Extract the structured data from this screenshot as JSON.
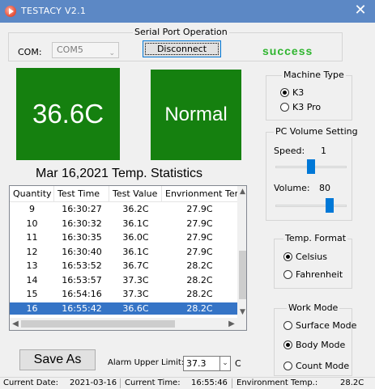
{
  "window": {
    "title": "TESTACY  V2.1",
    "close_glyph": "✕"
  },
  "serial": {
    "group_title": "Serial Port Operation",
    "com_label": "COM:",
    "com_value": "COM5",
    "disconnect_label": "Disconnect",
    "status_text": "success"
  },
  "display": {
    "temperature": "36.6C",
    "condition": "Normal",
    "panel_color": "#15800f"
  },
  "stats": {
    "title": "Mar 16,2021 Temp. Statistics",
    "columns": [
      "Quantity",
      "Test Time",
      "Test Value",
      "Envrionment Ten"
    ],
    "rows": [
      {
        "q": "9",
        "time": "16:30:27",
        "value": "36.2C",
        "env": "27.9C"
      },
      {
        "q": "10",
        "time": "16:30:32",
        "value": "36.1C",
        "env": "27.9C"
      },
      {
        "q": "11",
        "time": "16:30:35",
        "value": "36.0C",
        "env": "27.9C"
      },
      {
        "q": "12",
        "time": "16:30:40",
        "value": "36.1C",
        "env": "27.9C"
      },
      {
        "q": "13",
        "time": "16:53:52",
        "value": "36.7C",
        "env": "28.2C"
      },
      {
        "q": "14",
        "time": "16:53:57",
        "value": "37.3C",
        "env": "28.2C"
      },
      {
        "q": "15",
        "time": "16:54:16",
        "value": "37.3C",
        "env": "28.2C"
      },
      {
        "q": "16",
        "time": "16:55:42",
        "value": "36.6C",
        "env": "28.2C",
        "selected": true
      }
    ]
  },
  "machine_type": {
    "title": "Machine Type",
    "options": [
      "K3",
      "K3 Pro"
    ],
    "selected": "K3"
  },
  "volume": {
    "title": "PC Volume Setting",
    "speed_label": "Speed:",
    "speed_value": "1",
    "speed_level": 0.5,
    "volume_label": "Volume:",
    "volume_value": "80",
    "volume_level": 0.8
  },
  "temp_format": {
    "title": "Temp. Format",
    "options": [
      "Celsius",
      "Fahrenheit"
    ],
    "selected": "Celsius"
  },
  "work_mode": {
    "title": "Work Mode",
    "options": [
      "Surface Mode",
      "Body Mode",
      "Count Mode"
    ],
    "selected": "Body Mode"
  },
  "actions": {
    "save_as_label": "Save As",
    "alarm_label": "Alarm Upper Limit:",
    "alarm_value": "37.3",
    "alarm_unit": "C"
  },
  "statusbar": {
    "date_label": "Current Date:",
    "date_value": "2021-03-16",
    "time_label": "Current Time:",
    "time_value": "16:55:46",
    "env_label": "Environment Temp.:",
    "env_value": "28.2C"
  },
  "accent_color": "#0078d7",
  "selection_color": "#3574c6"
}
